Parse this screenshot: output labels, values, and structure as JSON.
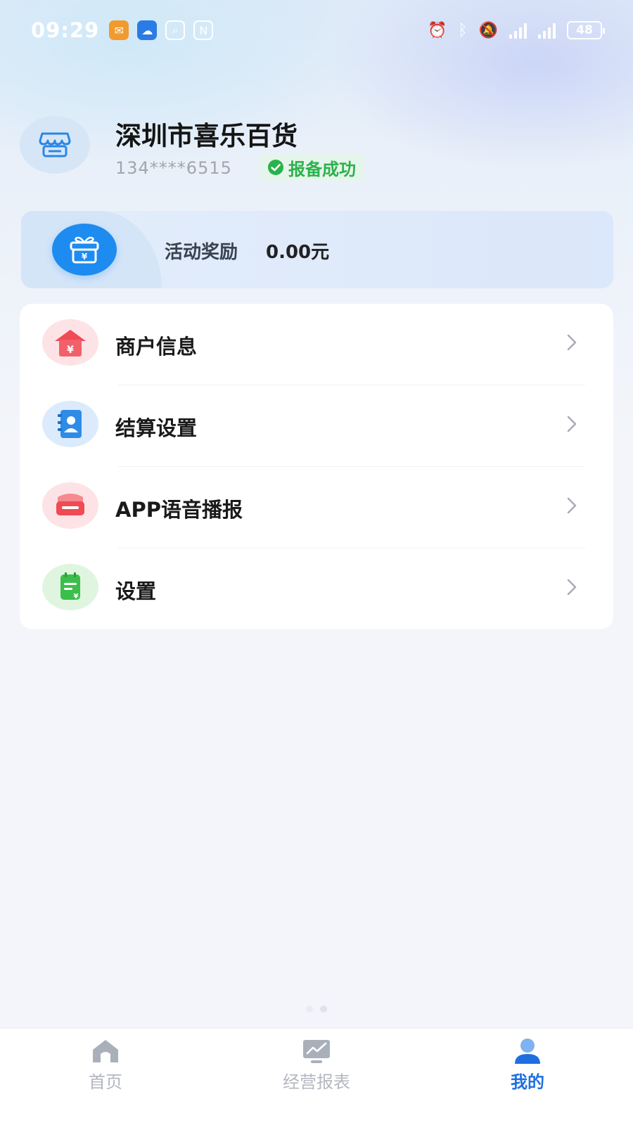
{
  "status_bar": {
    "time": "09:29",
    "battery": "48"
  },
  "profile": {
    "shop_name": "深圳市喜乐百货",
    "phone": "134****6515",
    "status": "报备成功"
  },
  "reward": {
    "label": "活动奖励",
    "value": "0.00元"
  },
  "menu": {
    "items": [
      {
        "label": "商户信息",
        "icon": "shop-house-icon",
        "color": "#f0505a"
      },
      {
        "label": "结算设置",
        "icon": "contact-book-icon",
        "color": "#2f8be8"
      },
      {
        "label": "APP语音播报",
        "icon": "speaker-box-icon",
        "color": "#f05a5a"
      },
      {
        "label": "设置",
        "icon": "notepad-icon",
        "color": "#3cbf4a"
      }
    ]
  },
  "tabbar": {
    "tabs": [
      {
        "label": "首页",
        "icon": "home-icon",
        "active": false
      },
      {
        "label": "经营报表",
        "icon": "report-chart-icon",
        "active": false
      },
      {
        "label": "我的",
        "icon": "user-icon",
        "active": true
      }
    ]
  },
  "colors": {
    "accent": "#1f6fe0",
    "success": "#2bb24c",
    "reward_icon": "#1e8bf0"
  }
}
